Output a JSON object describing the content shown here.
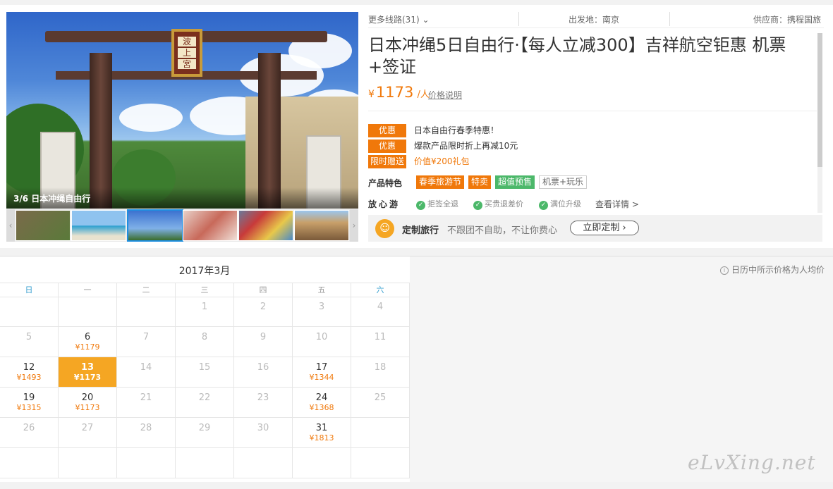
{
  "gallery": {
    "caption": "3/6 日本冲绳自由行",
    "plaque_chars": [
      "波",
      "上",
      "宮"
    ],
    "thumbnails": [
      "thumb-1",
      "thumb-2",
      "thumb-3",
      "thumb-4",
      "thumb-5",
      "thumb-6"
    ],
    "active_thumb": 3
  },
  "header": {
    "more_lines": "更多线路(31)",
    "departure": "出发地：南京",
    "supplier": "供应商：携程国旅"
  },
  "product": {
    "title": "日本冲绳5日自由行·【每人立减300】吉祥航空钜惠 机票+签证",
    "currency": "¥",
    "price": "1173",
    "unit": "/人",
    "price_note": "价格说明"
  },
  "promotions": [
    {
      "tag": "优惠",
      "text": "日本自由行春季特惠！",
      "highlight": false
    },
    {
      "tag": "优惠",
      "text": "爆款产品限时折上再减10元",
      "highlight": false
    },
    {
      "tag": "限时赠送",
      "text": "价值¥200礼包",
      "highlight": true
    }
  ],
  "features": {
    "label": "产品特色",
    "tags": [
      {
        "text": "春季旅游节",
        "style": "orange"
      },
      {
        "text": "特卖",
        "style": "orange"
      },
      {
        "text": "超值预售",
        "style": "green"
      },
      {
        "text": "机票+玩乐",
        "style": "plain"
      }
    ]
  },
  "assurance": {
    "label": "放心游",
    "items": [
      "拒签全退",
      "买贵退差价",
      "满位升级"
    ],
    "detail_link": "查看详情 >"
  },
  "custom": {
    "title": "定制旅行",
    "desc": "不跟团不自助，不让你费心",
    "button": "立即定制 ›"
  },
  "calendar": {
    "month": "2017年3月",
    "note": "日历中所示价格为人均价",
    "weekdays": [
      "日",
      "一",
      "二",
      "三",
      "四",
      "五",
      "六"
    ],
    "selected": "13",
    "weeks": [
      [
        null,
        null,
        null,
        {
          "d": "1"
        },
        {
          "d": "2"
        },
        {
          "d": "3"
        },
        {
          "d": "4"
        }
      ],
      [
        {
          "d": "5"
        },
        {
          "d": "6",
          "p": "¥1179"
        },
        {
          "d": "7"
        },
        {
          "d": "8"
        },
        {
          "d": "9"
        },
        {
          "d": "10"
        },
        {
          "d": "11"
        }
      ],
      [
        {
          "d": "12",
          "p": "¥1493"
        },
        {
          "d": "13",
          "p": "¥1173"
        },
        {
          "d": "14"
        },
        {
          "d": "15"
        },
        {
          "d": "16"
        },
        {
          "d": "17",
          "p": "¥1344"
        },
        {
          "d": "18"
        }
      ],
      [
        {
          "d": "19",
          "p": "¥1315"
        },
        {
          "d": "20",
          "p": "¥1173"
        },
        {
          "d": "21"
        },
        {
          "d": "22"
        },
        {
          "d": "23"
        },
        {
          "d": "24",
          "p": "¥1368"
        },
        {
          "d": "25"
        }
      ],
      [
        {
          "d": "26"
        },
        {
          "d": "27"
        },
        {
          "d": "28"
        },
        {
          "d": "29"
        },
        {
          "d": "30"
        },
        {
          "d": "31",
          "p": "¥1813"
        },
        null
      ],
      [
        null,
        null,
        null,
        null,
        null,
        null,
        null
      ]
    ]
  },
  "watermark": "eLvXing.net",
  "colors": {
    "accent": "#f0780a",
    "green": "#4cb86a",
    "selected": "#f5a623"
  }
}
